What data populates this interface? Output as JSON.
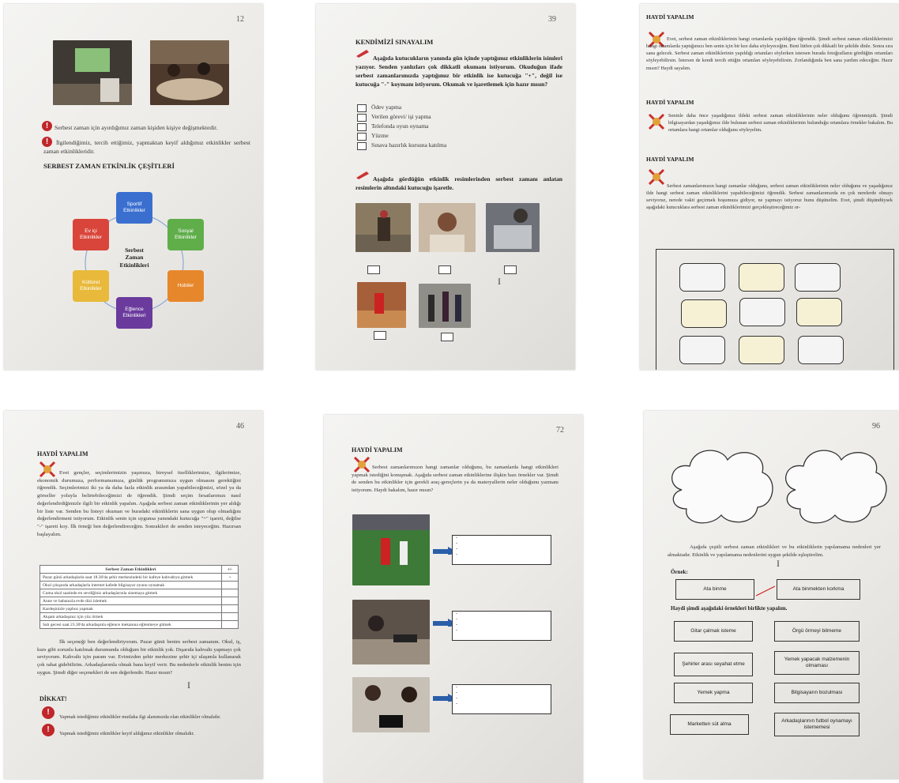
{
  "pages": [
    {
      "number": "12",
      "bullets": [
        "Serbest zaman için ayırdığımız zaman kişiden kişiye değişmektedir.",
        "İlgilendiğimiz, tercih ettiğimiz, yapmaktan keyif aldığımız etkinlikler serbest zaman etkinlikleridir."
      ],
      "section_title": "SERBEST ZAMAN ETKİNLİK ÇEŞİTLERİ",
      "diagram": {
        "center": [
          "Serbest",
          "Zaman",
          "Etkinlikleri"
        ],
        "nodes": [
          {
            "label": "Sportif Etkinlikler",
            "color": "#3a6fd0"
          },
          {
            "label": "Sosyal Etkinlikler",
            "color": "#5fae4a"
          },
          {
            "label": "Hobiler",
            "color": "#e7872b"
          },
          {
            "label": "Eğlence Etkinlikleri",
            "color": "#6a3a9c"
          },
          {
            "label": "Kültürel Etkinlikler",
            "color": "#e8b93a"
          },
          {
            "label": "Ev içi Etkinlikler",
            "color": "#d9453a"
          }
        ]
      }
    },
    {
      "number": "39",
      "title": "KENDİMİZİ SINAYALIM",
      "intro": "Aşağıda kutucukların yanında gün içinde yaptığımız etkinliklerin isimleri yazıyor. Senden yanlızları çok dikkatli okumanı istiyorum. Okuduğun ifade serbest zamanlarımızda yaptığımız bir etkinlik ise kutucuğa \"+\", değil ise kutucuğa \"-\" koymanı istiyorum. Okumak ve işaretlemek için hazır mısın?",
      "checklist": [
        "Ödev yapma",
        "Verilen görevi/ işi yapma",
        "Telefonda oyun oynama",
        "Yüzme",
        "Sınava hazırlık kursuna katılma"
      ],
      "instruction2": "Aşağıda gördüğün etkinlik resimlerinden serbest zamanı anlatan resimlerin altındaki kutucuğu işaretle."
    },
    {
      "heading": "HAYDİ YAPALIM",
      "p1": "Evet, serbest zaman etkinliklerinin hangi ortamlarda yapıldığını öğrendik. Şimdi serbest zaman etkinliklerimizi hangi ortamlarda yaptığımızı ben senin için bir kez daha söyleyeceğim. Beni lütfen çok dikkatli bir şekilde dinle. Sonra sıra sana gelecek. Serbest zaman etkinliklerinin yapıldığı ortamları söylerken istersen burada fotoğrafların gördüğün ortamları söyleyebilirsin. İstersen de kendi tercih ettiğin ortamları söyleyebilirsin. Zorlandığında ben sana yardım edeceğim. Hazır mısın? Haydi sayalım.",
      "heading2": "HAYDİ YAPALIM",
      "p2": "Seninle daha önce yaşadığımız ildeki serbest zaman etkinliklerinin neler olduğunu öğrenmiştik. Şimdi bilgisayardan yaşadığımız ilde bulunan serbest zaman etkinliklerinin bulunduğu ortamlara örnekler bakalım. Bu ortamlara hangi ortamlar olduğunu söyleyelim.",
      "heading3": "HAYDİ YAPALIM",
      "p3": "Serbest zamanlarımızın hangi zamanlar olduğunu, serbest zaman etkinliklerinin neler olduğunu ve yaşadığımız ilde hangi serbest zaman etkinliklerini yapabileceğimizi öğrendik. Serbest zamanlarımızda en çok nerelerde olmayı seviyoruz, nerede vakit geçirmek hoşumuza gidiyor, ne yapmayı istiyoruz bunu düşünelim. Evet, şimdi düşündüysek aşağıdaki kutucuklara serbest zaman etkinliklerimizi gerçekleştireceğimiz or-"
    },
    {
      "number": "46",
      "heading": "HAYDİ YAPALIM",
      "p1": "Evet gençler, seçimlerimizin yaşımıza, bireysel özelliklerimize, ilgilerimize, ekonomik durumuza, performansımıza, günlük programımıza uygun olmasını gerektiğini öğrendik. Seçimlerimizi iki ya da daha fazla etkinlik arasından yapabileceğimizi, sözel ya da görseller yoluyla belirtebileceğimizi de öğrendik. Şimdi seçim fırsatlarımızı nasıl değerlendirdiğimizle ilgili bir etkinlik yapalım. Aşağıda serbest zaman etkinliklerinin yer aldığı bir liste var. Senden bu listeyi okuman ve buradaki etkinliklerin sana uygun olup olmadığını değerlendirmeni istiyorum. Etkinlik senin için uygunsa yanındaki kutucuğa \"+\" işareti, değilse \"-\" işareti koy. İlk örneği ben değerlendireceğim. Sonrakileri de senden isteyeceğim. Hazırsan başlayalım.",
      "table": {
        "header": "Serbest Zaman Etkinlikleri",
        "header2": "+/-",
        "rows": [
          [
            "Pazar günü arkadaşlarla saat 18.30'da şehir merkezindeki bir kafeye kahvaltıya gitmek",
            "+"
          ],
          [
            "Okul çıkışında arkadaşlarla internet kafede bilgisayar oyunu oynamak",
            ""
          ],
          [
            "Cuma okul saatinde en sevdiğiniz arkadaşlarınla sinemaya gitmek",
            ""
          ],
          [
            "Anne ve babanızla evde dizi izlemek",
            ""
          ],
          [
            "Kardeşinizle yapboz yapmak",
            ""
          ],
          [
            "Akşam arkadaşınız için yüz örmek",
            ""
          ],
          [
            "Salı gecesi saat 23.30'da arkadaşınla eğlence mekanına eğlenmeye gitmek",
            ""
          ]
        ]
      },
      "p2": "İlk seçeneği ben değerlendiriyorum. Pazar günü benim serbest zamanım. Okul, iş, kurs gibi zorunlu katılmak durumunda olduğum bir etkinlik yok. Dışarıda kahvaltı yapmayı çok seviyorum. Kahvaltı için param var. Evimizden şehir merkezine şehir içi ulaşımla kullanarak çok rahat gidebilirim. Arkadaşlarımla olmak bana keyif verir. Bu nedenlerle etkinlik benim için uygun. Şimdi diğer seçenekleri de sen değerlendir. Hazır mısın?",
      "dikkat": "DİKKAT!",
      "w1": "Yapmak istediğimiz etkinlikler mutlaka ilgi alanımızda olan etkinlikler olmalıdır.",
      "w2": "Yapmak istediğimiz etkinlikler keyif aldığımız etkinlikler olmalıdır."
    },
    {
      "number": "72",
      "heading": "HAYDİ YAPALIM",
      "p1": "Serbest zamanlarımızın hangi zamanlar olduğunu, bu zamanlarda hangi etkinlikleri yapmak istediğini konuşmak. Aşağıda serbest zaman etkinliklerine ilişkin bazı örnekler var. Şimdi de senden bu etkinlikler için gerekli araç-gereçlerin ya da materyallerin neler olduğunu yazmanı istiyorum. Haydi bakalım, hazır mısın?",
      "dash": "-"
    },
    {
      "number": "96",
      "p1": "Aşağıda çeşitli serbest zaman etkinlikleri ve bu etkinliklerin yapılamama nedenleri yer almaktadır. Etkinlik ve yapılamama nedenlerini uygun şekilde eşleştirelim.",
      "ornek": "Örnek:",
      "example": [
        "Ata binme",
        "Ata binmekten korkma"
      ],
      "subhead": "Haydi şimdi aşağıdaki örnekleri birlikte yapalım.",
      "left": [
        "Gitar çalmak isteme",
        "Şehirler arası seyahat etme",
        "Yemek yapma",
        "Marketten süt alma"
      ],
      "right": [
        "Örgü örmeyi bilmeme",
        "Yemek yapacak malzemenin olmaması",
        "Bilgisayarın bozulması",
        "Arkadaşlarının futbol oynamayı istememesi"
      ]
    }
  ]
}
